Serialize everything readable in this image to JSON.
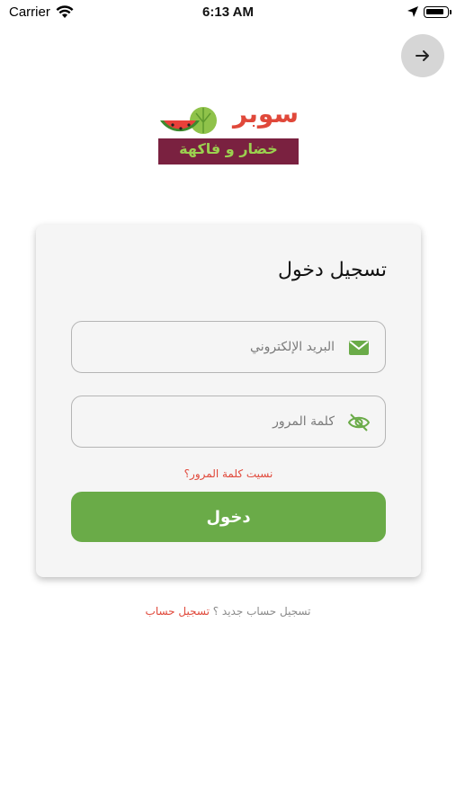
{
  "status_bar": {
    "carrier": "Carrier",
    "time": "6:13 AM",
    "wifi_icon": "wifi-icon",
    "location_icon": "location-arrow-icon",
    "battery_icon": "battery-icon",
    "battery_level": 0.85
  },
  "nav": {
    "forward_icon": "arrow-right-icon"
  },
  "logo": {
    "name_top": "سوبر",
    "name_bottom": "خضار و فاكهة",
    "icon": "watermelon-lettuce-logo-icon"
  },
  "login_card": {
    "title": "تسجيل دخول",
    "email": {
      "placeholder": "البريد الإلكتروني",
      "value": "",
      "icon": "mail-icon"
    },
    "password": {
      "placeholder": "كلمة المرور",
      "value": "",
      "icon": "eye-off-icon"
    },
    "forgot_password": "نسيت كلمة المرور؟",
    "login_button": "دخول"
  },
  "signup": {
    "question": "تسجيل حساب جديد ؟",
    "link": "تسجيل حساب"
  },
  "colors": {
    "primary_green": "#6aab48",
    "accent_red": "#e0483a",
    "logo_maroon": "#7a2140",
    "card_bg": "#f5f5f5"
  }
}
